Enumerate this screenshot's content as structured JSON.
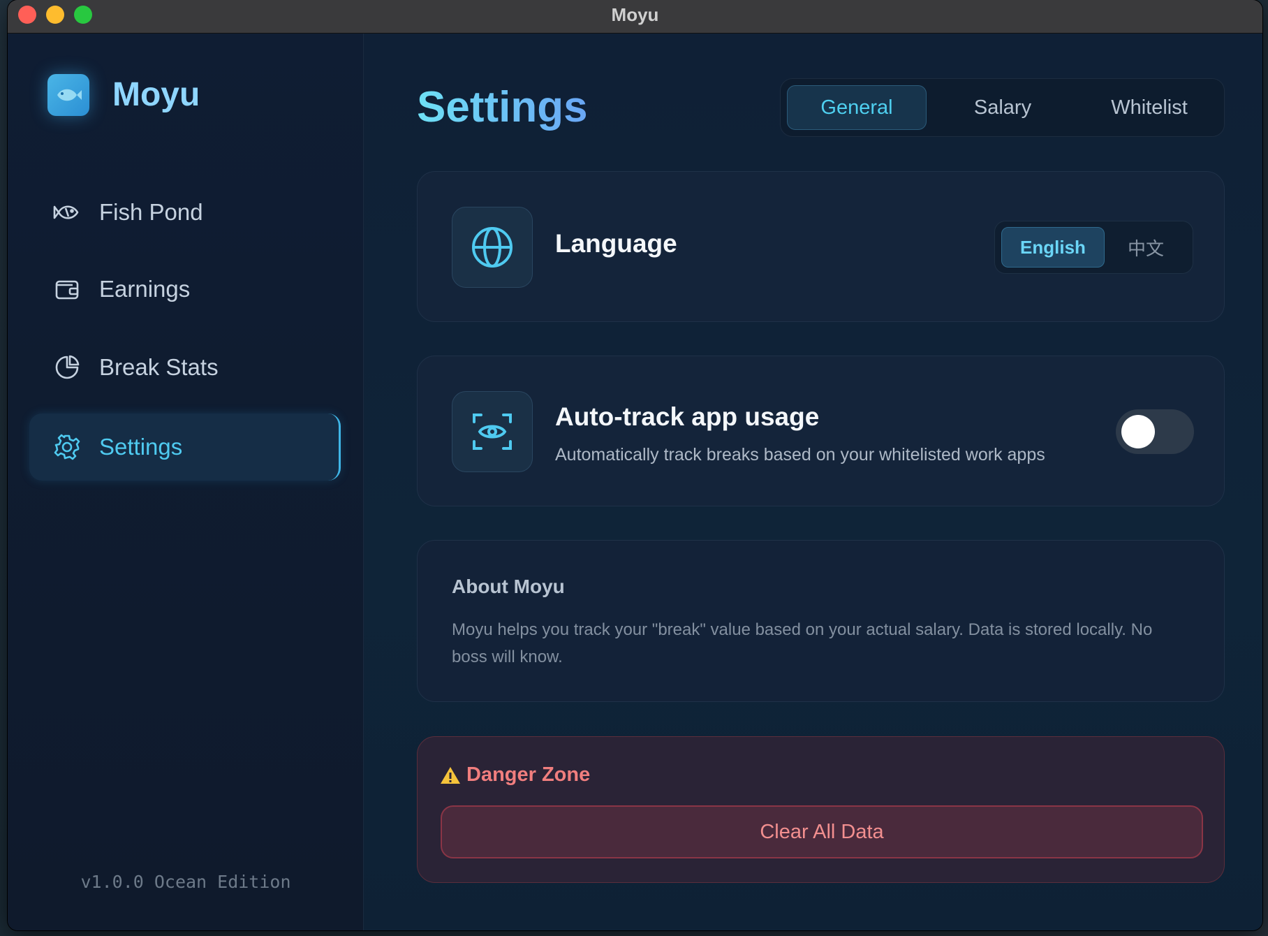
{
  "window": {
    "title": "Moyu"
  },
  "sidebar": {
    "brand": "Moyu",
    "items": [
      {
        "label": "Fish Pond",
        "icon": "fish-icon"
      },
      {
        "label": "Earnings",
        "icon": "wallet-icon"
      },
      {
        "label": "Break Stats",
        "icon": "pie-chart-icon"
      },
      {
        "label": "Settings",
        "icon": "gear-icon",
        "active": true
      }
    ],
    "version": "v1.0.0 Ocean Edition"
  },
  "main": {
    "title": "Settings",
    "tabs": [
      {
        "label": "General",
        "active": true
      },
      {
        "label": "Salary"
      },
      {
        "label": "Whitelist"
      }
    ],
    "language": {
      "title": "Language",
      "icon": "globe-icon",
      "options": [
        "English",
        "中文"
      ],
      "selected": "English"
    },
    "autotrack": {
      "title": "Auto-track app usage",
      "description": "Automatically track breaks based on your whitelisted work apps",
      "icon": "eye-scan-icon",
      "enabled": false
    },
    "about": {
      "title": "About Moyu",
      "text": "Moyu helps you track your \"break\" value based on your actual salary. Data is stored locally. No boss will know."
    },
    "danger": {
      "title": "Danger Zone",
      "icon": "warning-icon",
      "button": "Clear All Data"
    }
  },
  "colors": {
    "accent": "#4fcaf0",
    "danger": "#f07e7e",
    "background": "#0f2036"
  }
}
